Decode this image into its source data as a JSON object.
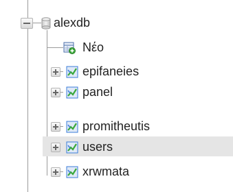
{
  "tree": {
    "db": {
      "label": "alexdb",
      "icon": "database-icon",
      "expanded": true
    },
    "new_item": {
      "label": "Νέο",
      "icon": "new-table-icon"
    },
    "tables": [
      {
        "label": "epifaneies",
        "icon": "table-icon",
        "expanded": false,
        "selected": false
      },
      {
        "label": "panel",
        "icon": "table-icon",
        "expanded": false,
        "selected": false
      },
      {
        "label": "promitheutis",
        "icon": "table-icon",
        "expanded": false,
        "selected": false
      },
      {
        "label": "users",
        "icon": "table-icon",
        "expanded": false,
        "selected": true
      },
      {
        "label": "xrwmata",
        "icon": "table-icon",
        "expanded": false,
        "selected": false
      }
    ]
  },
  "colors": {
    "highlight": "#e5e5e5",
    "tree_line": "#9a9a9a",
    "table_icon_blue": "#3b7dd8",
    "table_icon_green": "#3aa83a"
  }
}
